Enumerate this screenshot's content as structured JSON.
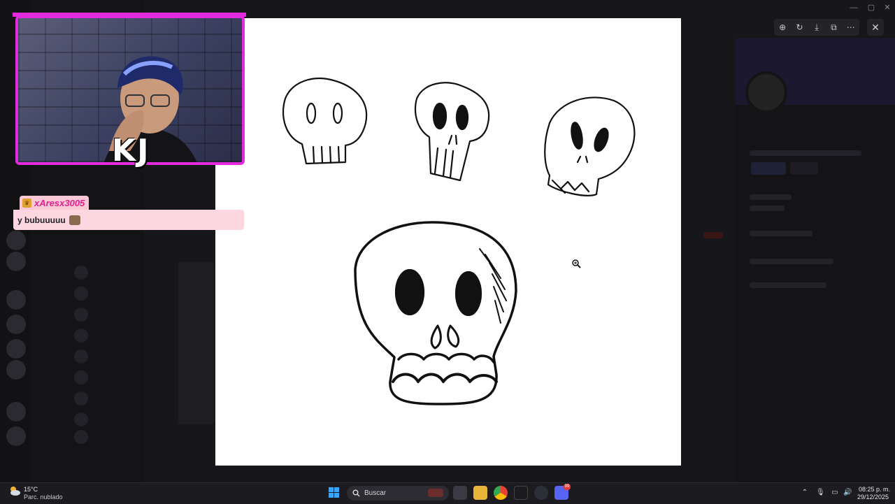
{
  "overlay": {
    "streamer_initials": "KJ",
    "chat_username": "xAresx3005",
    "chat_message": "y bubuuuuu"
  },
  "viewer": {
    "toolbar_icons": [
      "zoom-in-icon",
      "rotate-icon",
      "download-icon",
      "open-external-icon",
      "more-icon"
    ],
    "close_icon": "close-icon"
  },
  "taskbar": {
    "weather_temp": "15°C",
    "weather_desc": "Parc. nublado",
    "search_placeholder": "Buscar",
    "clock_time": "08:25 p. m.",
    "clock_date": "29/12/2025",
    "discord_badge": "99",
    "apps": [
      "start-icon",
      "search-icon",
      "file-explorer-icon",
      "folder-icon",
      "chrome-icon",
      "terminal-icon",
      "steam-icon",
      "discord-icon"
    ]
  },
  "colors": {
    "overlay_accent": "#e32adf",
    "chat_bg": "#fcd6e0",
    "chat_username": "#e31f8e",
    "viewer_bg": "#ffffff"
  }
}
